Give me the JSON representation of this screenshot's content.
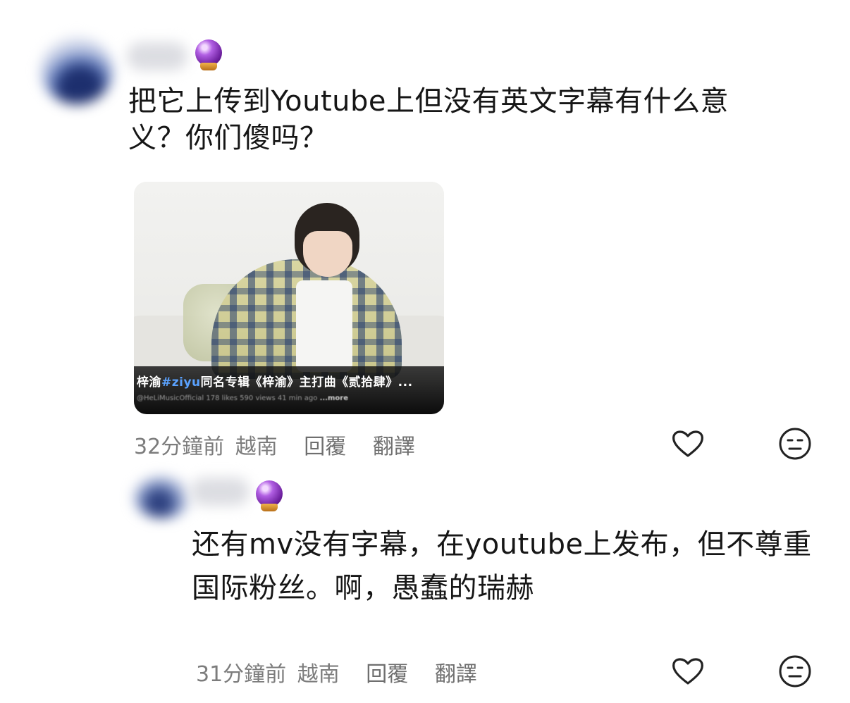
{
  "comments": [
    {
      "username": "",
      "badge_icon": "crystal-ball-icon",
      "text": "把它上传到Youtube上但没有英文字幕有什么意义？你们傻吗？",
      "attachment": {
        "title_prefix": "梓渝",
        "title_tag": "#ziyu",
        "title_rest": "同名专辑《梓渝》主打曲《贰拾肆》...",
        "meta": "@HeLiMusicOfficial  178 likes  590 views  41 min ago",
        "more": "...more"
      },
      "time": "32分鐘前",
      "location": "越南",
      "reply_label": "回覆",
      "translate_label": "翻譯"
    },
    {
      "username": "",
      "badge_icon": "crystal-ball-icon",
      "text": "还有mv没有字幕，在youtube上发布，但不尊重国际粉丝。啊，愚蠢的瑞赫",
      "time": "31分鐘前",
      "location": "越南",
      "reply_label": "回覆",
      "translate_label": "翻譯"
    }
  ],
  "colors": {
    "text": "#161616",
    "meta": "#7c7c7c",
    "tag": "#5aa2ff",
    "badge": "#8a2fc0"
  }
}
